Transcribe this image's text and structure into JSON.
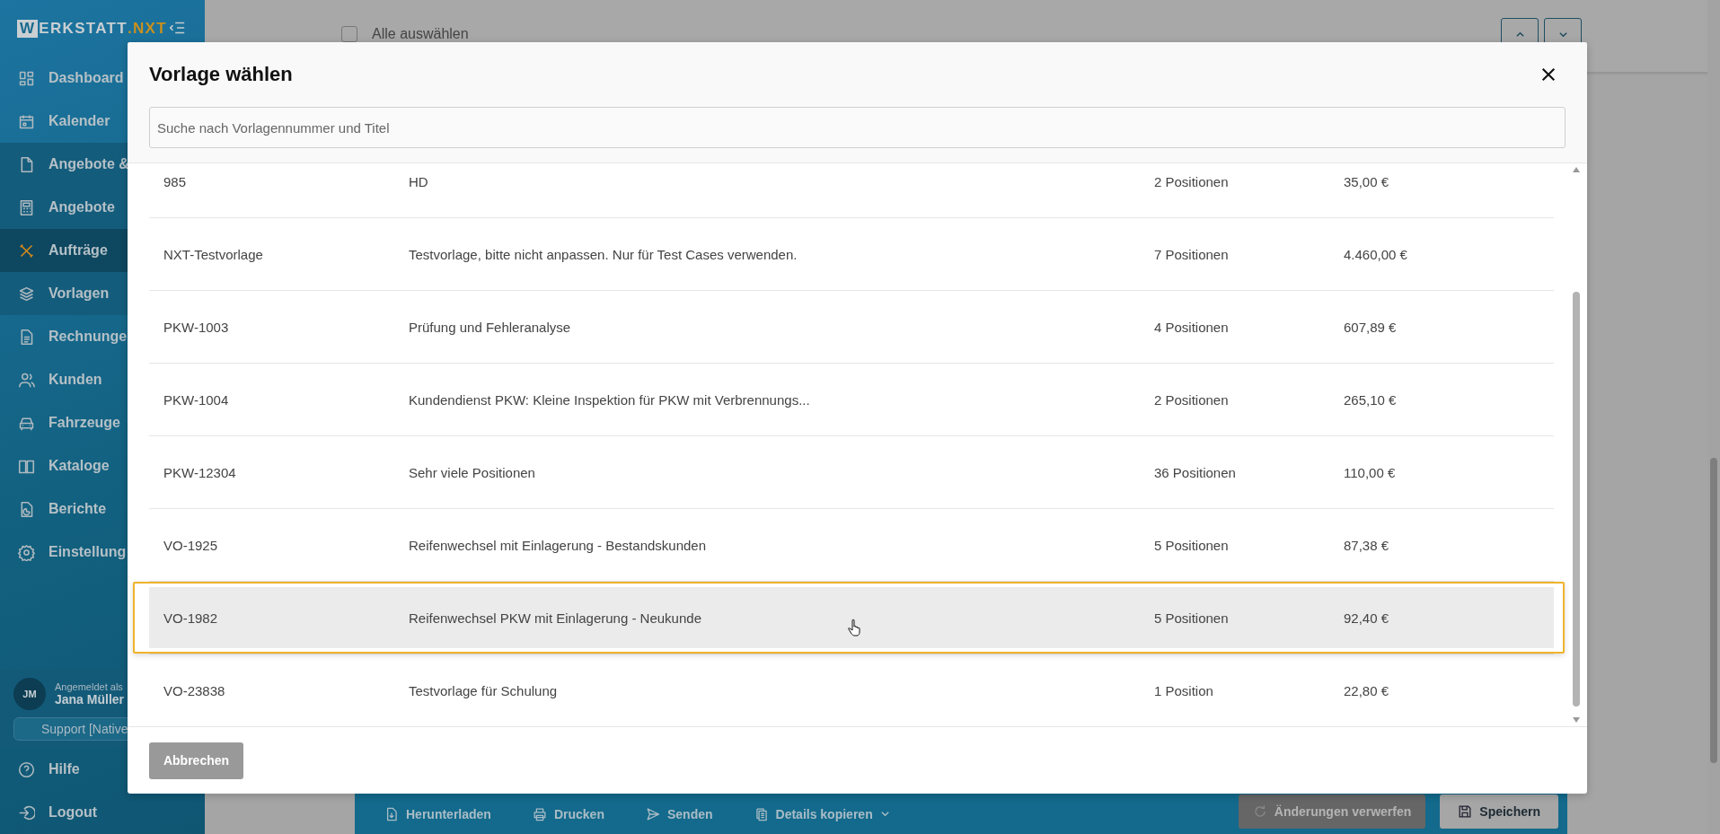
{
  "sidebar": {
    "logo": {
      "mark": "W",
      "text": "ERKSTATT",
      "accent": ".NXT"
    },
    "nav": [
      {
        "label": "Dashboard",
        "selected": false
      },
      {
        "label": "Kalender",
        "selected": false
      },
      {
        "label": "Angebote &",
        "selected": false,
        "expanded": true,
        "children": [
          {
            "label": "Angebote",
            "selected": false
          },
          {
            "label": "Aufträge",
            "selected": true
          },
          {
            "label": "Vorlagen",
            "selected": false
          }
        ]
      },
      {
        "label": "Rechnunge",
        "selected": false
      },
      {
        "label": "Kunden",
        "selected": false
      },
      {
        "label": "Fahrzeuge",
        "selected": false
      },
      {
        "label": "Kataloge",
        "selected": false
      },
      {
        "label": "Berichte",
        "selected": false
      },
      {
        "label": "Einstellung",
        "selected": false
      }
    ],
    "user": {
      "initials": "JM",
      "caption": "Angemeldet als",
      "name": "Jana Müller"
    },
    "support": "Support [Native",
    "footer_nav": [
      {
        "label": "Hilfe"
      },
      {
        "label": "Logout"
      }
    ]
  },
  "background_page": {
    "select_all": {
      "label": "Alle auswählen",
      "checked": false
    },
    "actions": [
      {
        "label": "Herunterladen",
        "dropdown": false
      },
      {
        "label": "Drucken",
        "dropdown": false
      },
      {
        "label": "Senden",
        "dropdown": false
      },
      {
        "label": "Details kopieren",
        "dropdown": true
      }
    ],
    "discard_button": {
      "label": "Änderungen verwerfen",
      "disabled": true
    },
    "save_button": "Speichern"
  },
  "dialog": {
    "title": "Vorlage wählen",
    "search": {
      "placeholder": "Suche nach Vorlagennummer und Titel"
    },
    "rows": [
      {
        "number": "985",
        "title": "HD",
        "positions": "2 Positionen",
        "price": "35,00 €",
        "selected": false
      },
      {
        "number": "NXT-Testvorlage",
        "title": "Testvorlage, bitte nicht anpassen. Nur für Test Cases verwenden.",
        "positions": "7 Positionen",
        "price": "4.460,00 €",
        "selected": false
      },
      {
        "number": "PKW-1003",
        "title": "Prüfung und Fehleranalyse",
        "positions": "4 Positionen",
        "price": "607,89 €",
        "selected": false
      },
      {
        "number": "PKW-1004",
        "title": "Kundendienst PKW: Kleine Inspektion für PKW mit Verbrennungs...",
        "positions": "2 Positionen",
        "price": "265,10 €",
        "selected": false
      },
      {
        "number": "PKW-12304",
        "title": "Sehr viele Positionen",
        "positions": "36 Positionen",
        "price": "110,00 €",
        "selected": false
      },
      {
        "number": "VO-1925",
        "title": "Reifenwechsel mit Einlagerung - Bestandskunden",
        "positions": "5 Positionen",
        "price": "87,38 €",
        "selected": false
      },
      {
        "number": "VO-1982",
        "title": "Reifenwechsel PKW mit Einlagerung - Neukunde",
        "positions": "5 Positionen",
        "price": "92,40 €",
        "selected": true
      },
      {
        "number": "VO-23838",
        "title": "Testvorlage für Schulung",
        "positions": "1 Position",
        "price": "22,80 €",
        "selected": false
      }
    ],
    "cancel_button": "Abbrechen"
  }
}
